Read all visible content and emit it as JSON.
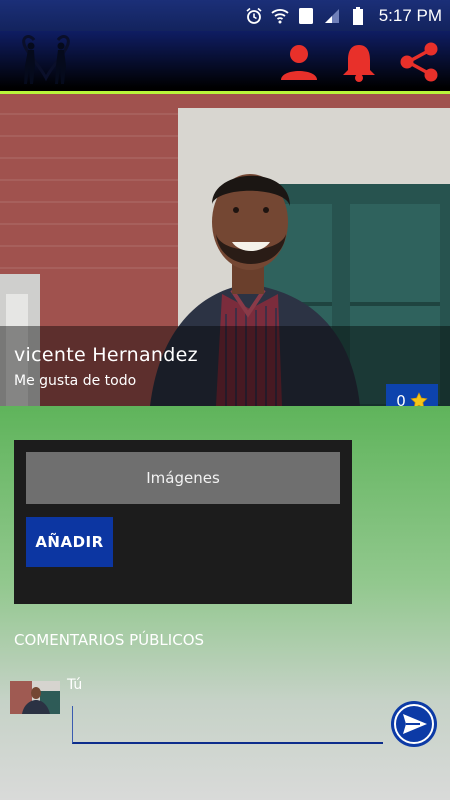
{
  "status_bar": {
    "time": "5:17 PM",
    "icons": [
      "alarm-icon",
      "wifi-icon",
      "sim-icon",
      "signal-icon",
      "battery-icon"
    ],
    "sim_label": "1"
  },
  "app_bar": {
    "logo": "couple-heart-logo",
    "actions": [
      "profile-icon",
      "bell-icon",
      "share-icon"
    ],
    "colors": {
      "action_red": "#e8302a",
      "accent_line": "#b8f53b"
    }
  },
  "profile": {
    "name": "vicente Hernandez",
    "status": "Me gusta de todo",
    "stars": "0"
  },
  "gallery": {
    "images_label": "Imágenes",
    "add_label": "AÑADIR"
  },
  "comments": {
    "title": "COMENTARIOS PÚBLICOS",
    "author": "Tú",
    "input_value": "",
    "send": "send-icon"
  }
}
